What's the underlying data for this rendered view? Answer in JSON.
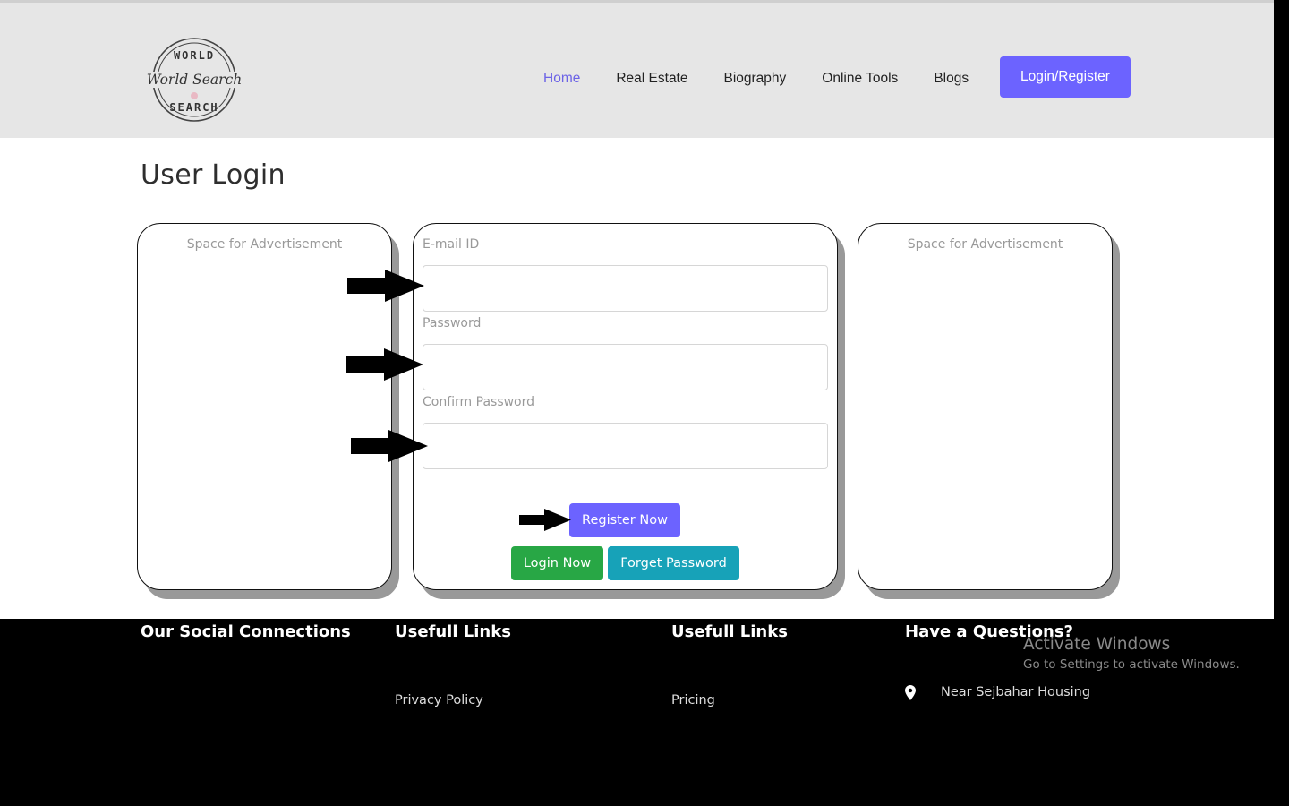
{
  "header": {
    "logo": {
      "top_text": "WORLD",
      "middle_text": "World Search",
      "bottom_text": "SEARCH"
    },
    "nav": [
      {
        "label": "Home",
        "active": true
      },
      {
        "label": "Real Estate",
        "active": false
      },
      {
        "label": "Biography",
        "active": false
      },
      {
        "label": "Online Tools",
        "active": false
      },
      {
        "label": "Blogs",
        "active": false
      }
    ],
    "login_register_label": "Login/Register"
  },
  "page": {
    "title": "User Login"
  },
  "ads": {
    "left_text": "Space for Advertisement",
    "right_text": "Space for Advertisement"
  },
  "form": {
    "email_label": "E-mail ID",
    "email_value": "",
    "password_label": "Password",
    "password_value": "",
    "confirm_label": "Confirm Password",
    "confirm_value": "",
    "register_label": "Register Now",
    "login_label": "Login Now",
    "forget_label": "Forget Password"
  },
  "annotations": {
    "arrows": [
      "email-field",
      "password-field",
      "confirm-password-field",
      "register-button"
    ]
  },
  "footer": {
    "social_heading": "Our Social Connections",
    "links1_heading": "Usefull Links",
    "links1": [
      "Privacy Policy"
    ],
    "links2_heading": "Usefull Links",
    "links2": [
      "Pricing"
    ],
    "contact_heading": "Have a Questions?",
    "address": "Near Sejbahar Housing",
    "address_icon": "map-pin-icon"
  },
  "os_overlay": {
    "watermark_title": "Activate Windows",
    "watermark_subtitle": "Go to Settings to activate Windows."
  },
  "colors": {
    "accent": "#6c63ff",
    "nav_active": "#6c63e6",
    "success": "#28a745",
    "info": "#17a2b8",
    "header_bg": "#e6e6e6",
    "footer_bg": "#000000"
  }
}
